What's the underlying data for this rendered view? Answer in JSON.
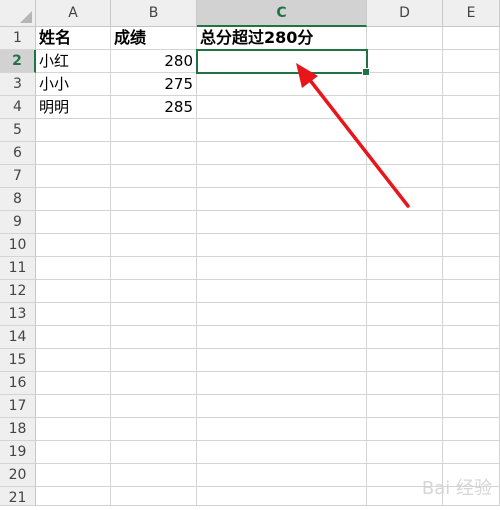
{
  "columns": [
    "A",
    "B",
    "C",
    "D",
    "E"
  ],
  "rows": [
    "1",
    "2",
    "3",
    "4",
    "5",
    "6",
    "7",
    "8",
    "9",
    "10",
    "11",
    "12",
    "13",
    "14",
    "15",
    "16",
    "17",
    "18",
    "19",
    "20",
    "21"
  ],
  "header_row": {
    "a": "姓名",
    "b": "成绩",
    "c": "总分超过280分"
  },
  "data_rows": [
    {
      "name": "小红",
      "score": "280"
    },
    {
      "name": "小小",
      "score": "275"
    },
    {
      "name": "明明",
      "score": "285"
    }
  ],
  "selected_cell": "C2",
  "colors": {
    "accent": "#217346",
    "arrow": "#e8161b"
  },
  "watermark_text": "Bai 经验"
}
